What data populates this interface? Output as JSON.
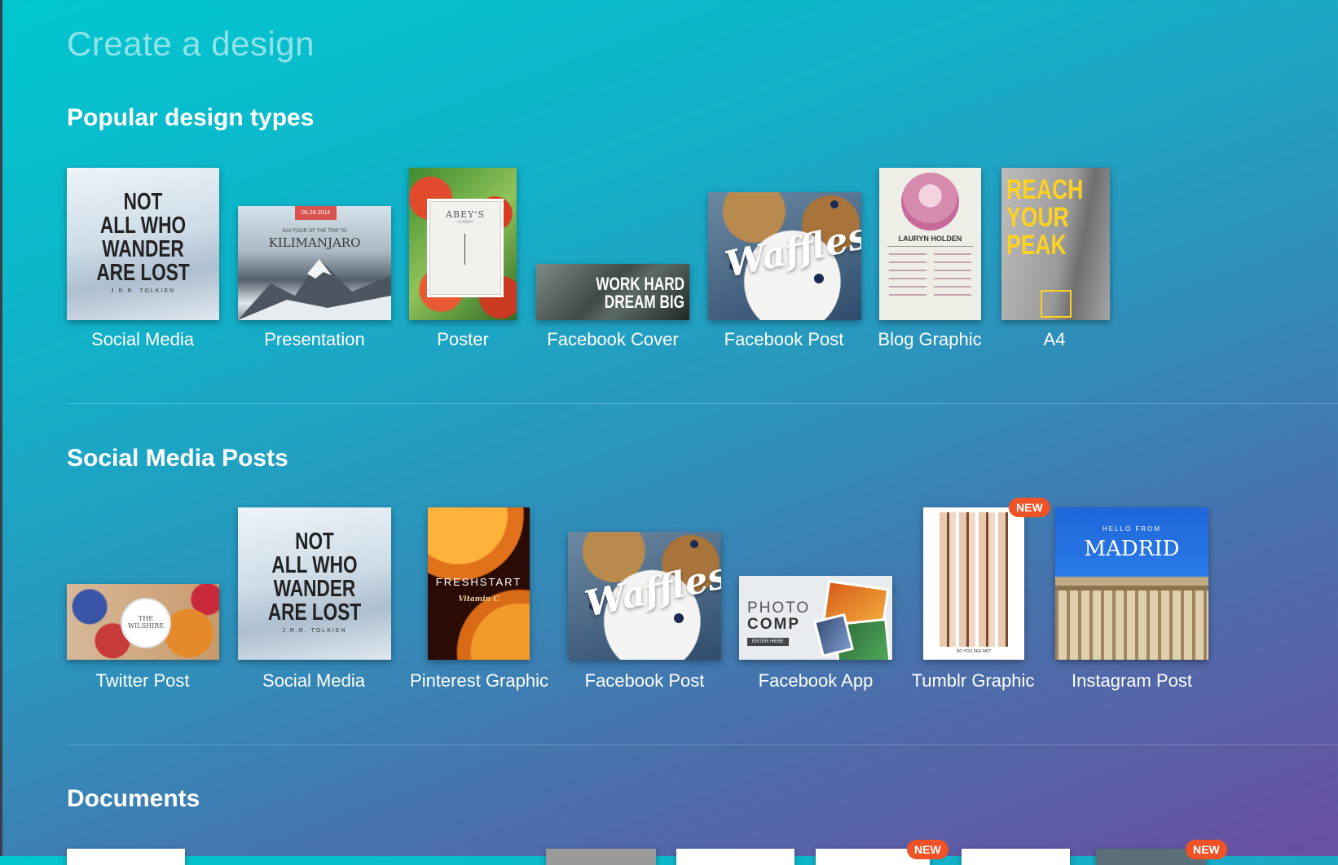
{
  "page": {
    "title": "Create a design",
    "sections": {
      "popular": {
        "title": "Popular design types",
        "items": [
          {
            "label": "Social Media",
            "thumb_text": [
              "NOT",
              "ALL WHO",
              "WANDER",
              "ARE LOST"
            ],
            "thumb_sub": "J.R.R. TOLKIEN"
          },
          {
            "label": "Presentation",
            "thumb_date": "05.28.2014",
            "thumb_sub": "DAY FOUR OF THE TRIP TO",
            "thumb_text": "KILIMANJARO"
          },
          {
            "label": "Poster",
            "thumb_text": "ABEY'S",
            "thumb_sub": "CLASSY"
          },
          {
            "label": "Facebook Cover",
            "thumb_text": [
              "WORK HARD",
              "DREAM BIG"
            ]
          },
          {
            "label": "Facebook Post",
            "thumb_text": "Waffles"
          },
          {
            "label": "Blog Graphic",
            "thumb_text": "LAURYN HOLDEN"
          },
          {
            "label": "A4",
            "thumb_text": [
              "REACH",
              "YOUR",
              "PEAK"
            ]
          }
        ]
      },
      "social": {
        "title": "Social Media Posts",
        "items": [
          {
            "label": "Twitter Post",
            "thumb_text": "THE WILSHIRE"
          },
          {
            "label": "Social Media",
            "thumb_text": [
              "NOT",
              "ALL WHO",
              "WANDER",
              "ARE LOST"
            ],
            "thumb_sub": "J.R.R. TOLKIEN"
          },
          {
            "label": "Pinterest Graphic",
            "thumb_text": "FRESHSTART",
            "thumb_sub": "Vitamin C"
          },
          {
            "label": "Facebook Post",
            "thumb_text": "Waffles"
          },
          {
            "label": "Facebook App",
            "thumb_text": [
              "PHOTO",
              "COMP"
            ],
            "thumb_sub": "ENTER HERE"
          },
          {
            "label": "Tumblr Graphic",
            "badge": "NEW",
            "thumb_sub": "DO YOU SEE ME?"
          },
          {
            "label": "Instagram Post",
            "thumb_sub": "HELLO FROM",
            "thumb_text": "MADRID"
          }
        ]
      },
      "documents": {
        "title": "Documents",
        "badges": [
          "NEW",
          "NEW"
        ]
      }
    }
  },
  "colors": {
    "gradient_start": "#00c7cf",
    "gradient_end": "#6a4ea0",
    "badge": "#f05228",
    "a4_text": "#ffd21f"
  }
}
